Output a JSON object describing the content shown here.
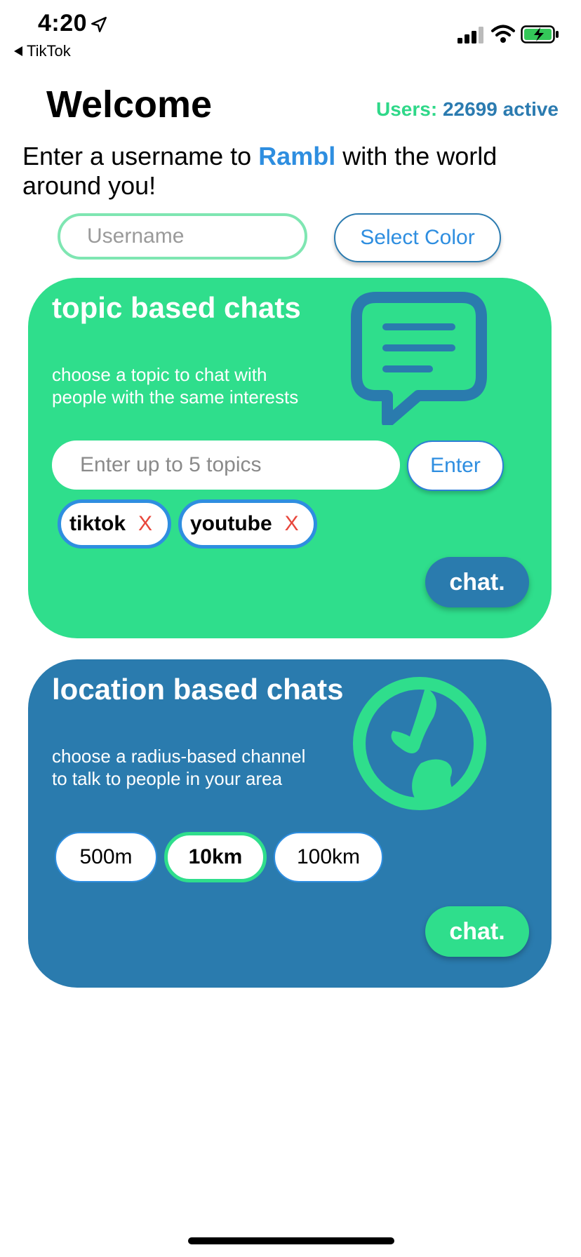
{
  "status_bar": {
    "time": "4:20",
    "back_app": "TikTok"
  },
  "header": {
    "title": "Welcome",
    "users_label": "Users:",
    "users_count": "22699 active"
  },
  "intro": {
    "before": "Enter a username to ",
    "brand": "Rambl",
    "after": " with the world around you!"
  },
  "username": {
    "placeholder": "Username",
    "value": ""
  },
  "select_color_label": "Select Color",
  "topic_card": {
    "title": "topic based chats",
    "description": "choose a topic to chat with people with the same interests",
    "topics_placeholder": "Enter up to 5 topics",
    "enter_label": "Enter",
    "topics": [
      {
        "label": "tiktok",
        "remove": "X"
      },
      {
        "label": "youtube",
        "remove": "X"
      }
    ],
    "chat_label": "chat."
  },
  "location_card": {
    "title": "location based chats",
    "description": "choose a radius-based channel to talk to people in your area",
    "radii": [
      "500m",
      "10km",
      "100km"
    ],
    "selected_radius": "10km",
    "chat_label": "chat."
  },
  "colors": {
    "green": "#2fde8c",
    "blue": "#2a7bae",
    "accent_blue": "#2e8ee0",
    "remove_red": "#e8473c"
  },
  "icons": {
    "topic_card": "chat-bubble-icon",
    "location_card": "globe-icon"
  }
}
